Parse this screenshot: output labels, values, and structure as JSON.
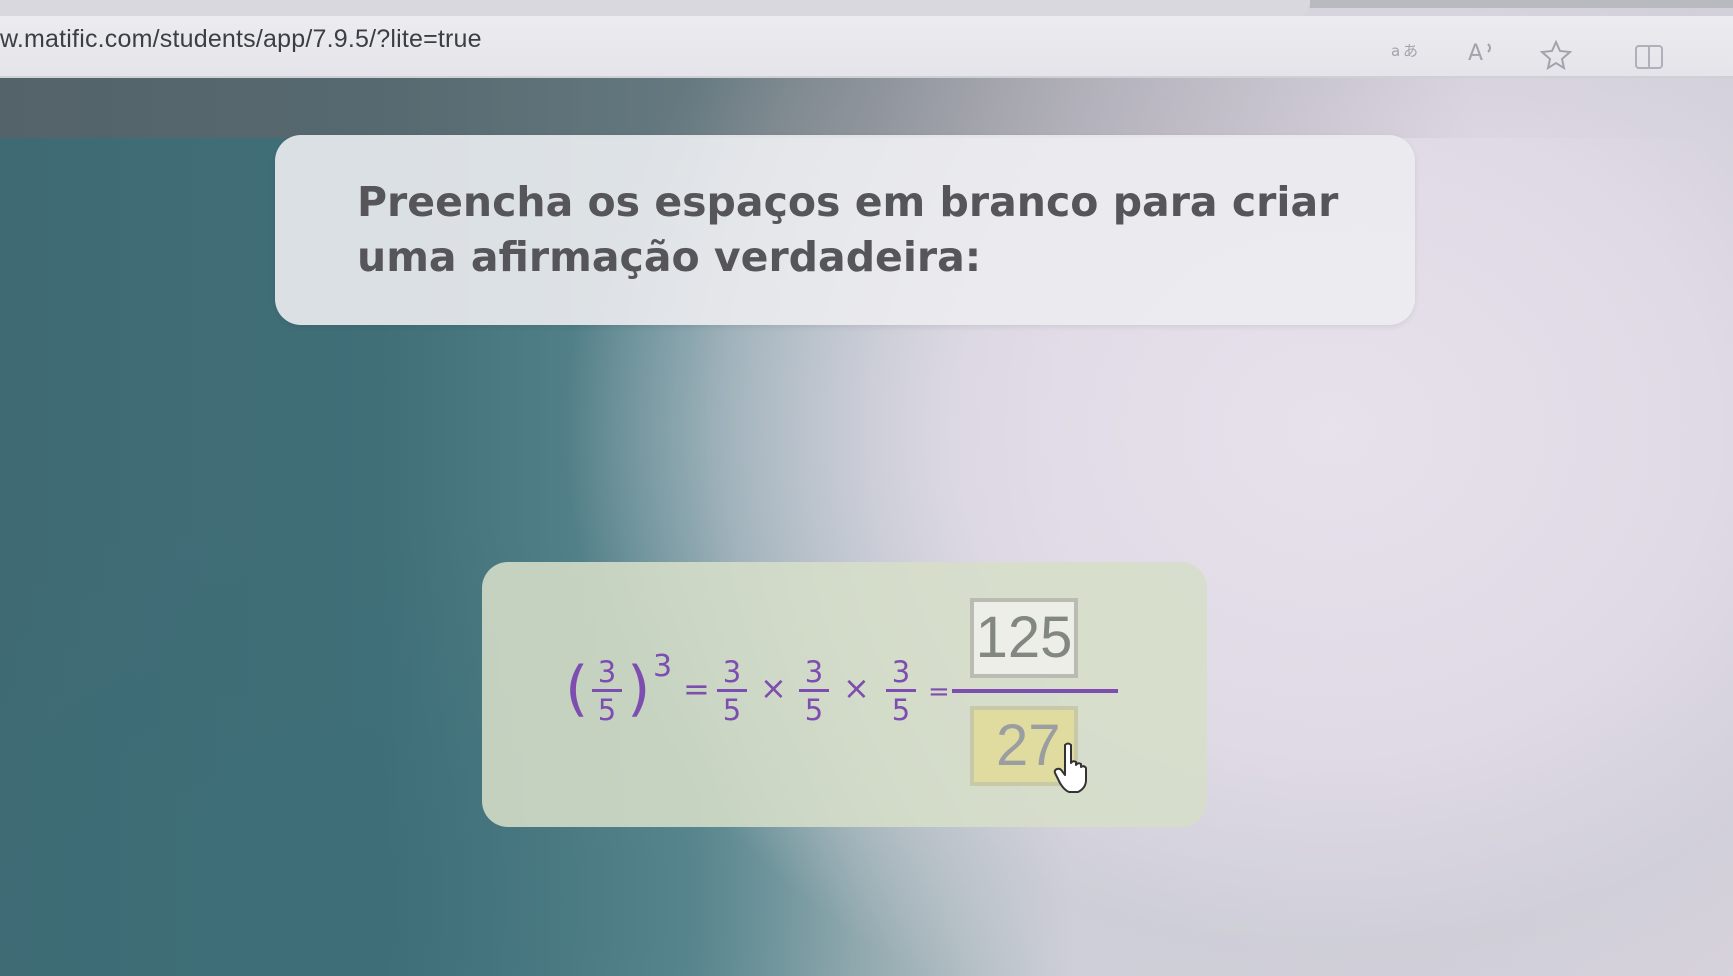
{
  "browser": {
    "url": "w.matific.com/students/app/7.9.5/?lite=true",
    "icons": [
      "translate-icon",
      "read-aloud-icon",
      "favorite-star-icon",
      "split-screen-icon"
    ]
  },
  "instruction": {
    "text": "Preencha os espaços em branco para criar uma afirmação verdadeira:"
  },
  "equation": {
    "base_numerator": "3",
    "base_denominator": "5",
    "exponent": "3",
    "equals": "=",
    "times": "×",
    "factors": [
      {
        "numerator": "3",
        "denominator": "5"
      },
      {
        "numerator": "3",
        "denominator": "5"
      },
      {
        "numerator": "3",
        "denominator": "5"
      }
    ],
    "answer_numerator": "125",
    "answer_denominator": "27"
  },
  "colors": {
    "math_purple": "#7d4eb0",
    "answer_highlight": "#e0dc9f"
  }
}
